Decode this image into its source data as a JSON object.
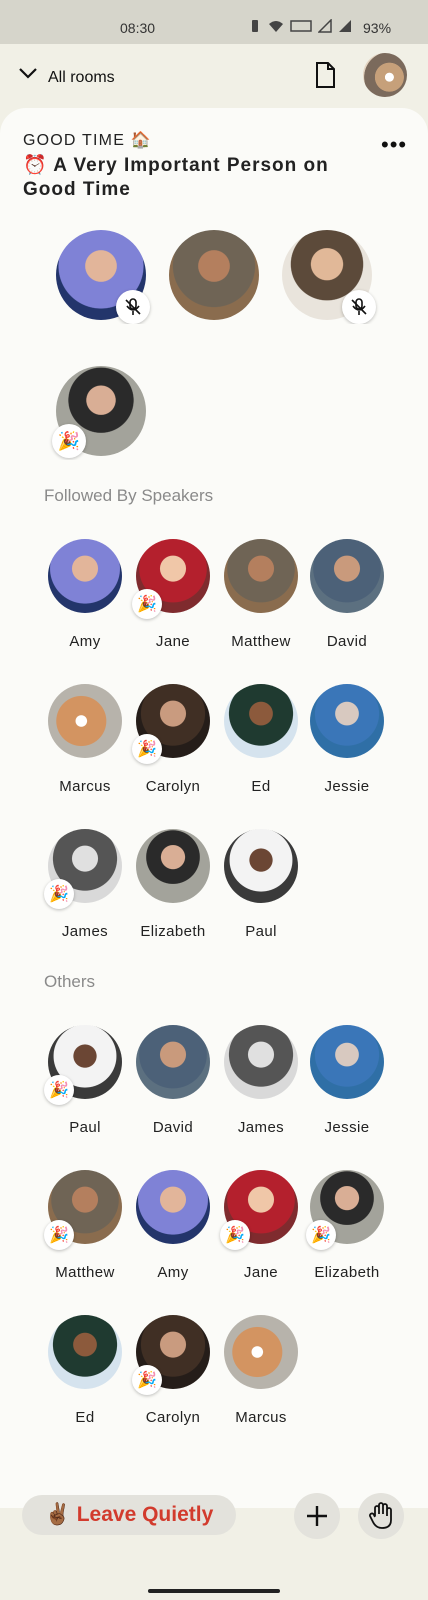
{
  "status_bar": {
    "time": "08:30",
    "battery": "93%"
  },
  "header": {
    "back_label": "All rooms"
  },
  "room": {
    "club_label": "GOOD TIME 🏠",
    "title": "⏰ A Very Important Person on Good Time",
    "more_label": "•••"
  },
  "speakers": [
    {
      "badge": "mic-off"
    },
    {
      "badge": ""
    },
    {
      "badge": "mic-off"
    },
    {
      "badge": "🎉"
    }
  ],
  "followed_section": {
    "title": "Followed By Speakers",
    "people": [
      {
        "name": "Amy",
        "badge": ""
      },
      {
        "name": "Jane",
        "badge": "🎉"
      },
      {
        "name": "Matthew",
        "badge": ""
      },
      {
        "name": "David",
        "badge": ""
      },
      {
        "name": "Marcus",
        "badge": ""
      },
      {
        "name": "Carolyn",
        "badge": "🎉"
      },
      {
        "name": "Ed",
        "badge": ""
      },
      {
        "name": "Jessie",
        "badge": ""
      },
      {
        "name": "James",
        "badge": "🎉"
      },
      {
        "name": "Elizabeth",
        "badge": ""
      },
      {
        "name": "Paul",
        "badge": ""
      }
    ]
  },
  "others_section": {
    "title": "Others",
    "people": [
      {
        "name": "Paul",
        "badge": "🎉"
      },
      {
        "name": "David",
        "badge": ""
      },
      {
        "name": "James",
        "badge": ""
      },
      {
        "name": "Jessie",
        "badge": ""
      },
      {
        "name": "Matthew",
        "badge": "🎉"
      },
      {
        "name": "Amy",
        "badge": ""
      },
      {
        "name": "Jane",
        "badge": "🎉"
      },
      {
        "name": "Elizabeth",
        "badge": "🎉"
      },
      {
        "name": "Ed",
        "badge": ""
      },
      {
        "name": "Carolyn",
        "badge": "🎉"
      },
      {
        "name": "Marcus",
        "badge": ""
      }
    ]
  },
  "footer": {
    "leave_label": "✌🏾 Leave Quietly",
    "add_icon": "plus-icon",
    "raise_hand_icon": "hand-icon"
  },
  "colors": {
    "leave_text": "#d23b2d",
    "background": "#f1f0e6"
  }
}
